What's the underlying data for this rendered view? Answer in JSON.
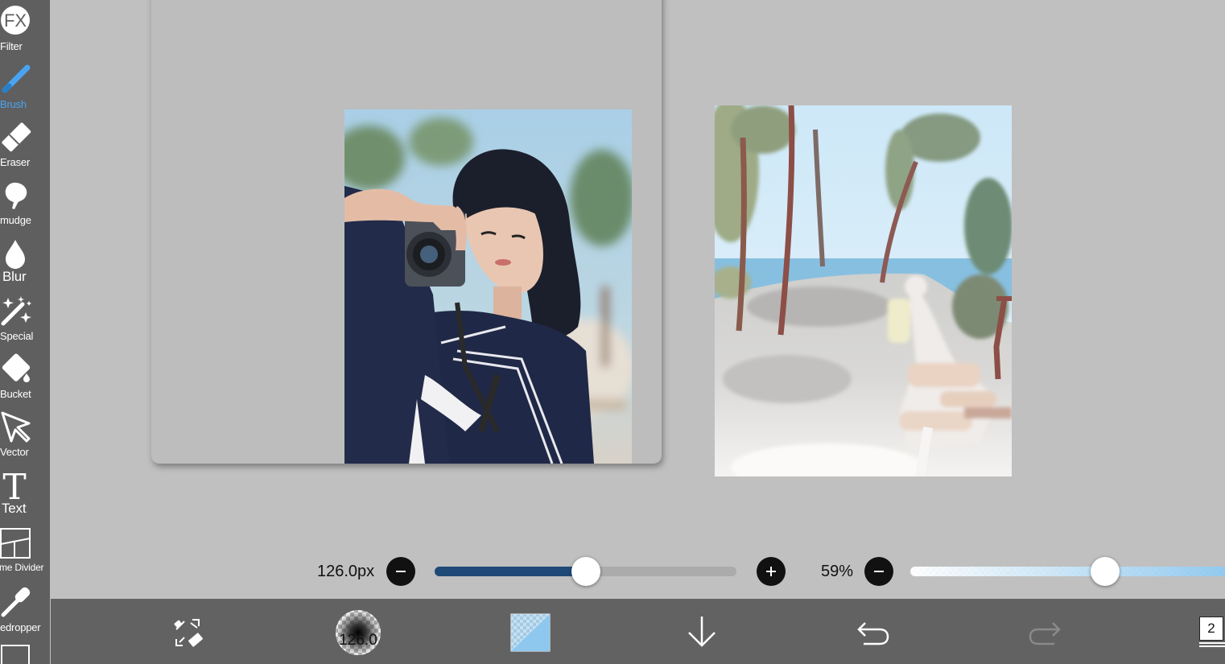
{
  "toolbar": {
    "fx_label": "FX",
    "tools": [
      {
        "id": "filter",
        "label": "Filter"
      },
      {
        "id": "brush",
        "label": "Brush"
      },
      {
        "id": "eraser",
        "label": "Eraser"
      },
      {
        "id": "smudge",
        "label": "mudge"
      },
      {
        "id": "blur",
        "label": "Blur"
      },
      {
        "id": "special",
        "label": "Special"
      },
      {
        "id": "bucket",
        "label": "Bucket"
      },
      {
        "id": "vector",
        "label": "Vector"
      },
      {
        "id": "text",
        "label": "Text"
      },
      {
        "id": "frame-divider",
        "label": "me Divider"
      },
      {
        "id": "eyedropper",
        "label": "edropper"
      }
    ],
    "active_tool": "brush"
  },
  "brush_settings": {
    "size_text": "126.0px",
    "size_fraction": 0.5,
    "opacity_text": "59%",
    "opacity_fraction": 0.59
  },
  "bottom_bar": {
    "brush_size_label": "126.0",
    "layer_count": "2"
  },
  "colors": {
    "accent": "#4aa3f0",
    "toolbar_bg": "#5f5f5f",
    "bottom_bar_bg": "#626262",
    "canvas_bg": "#c0c0c0",
    "size_track_fill": "#1f4a78",
    "opacity_track_fill": "#8ec8ef"
  },
  "icons": {
    "fx": "fx-circle-icon",
    "brush": "brush-icon",
    "eraser": "eraser-icon",
    "smudge": "smudge-icon",
    "blur": "drop-icon",
    "special": "magic-wand-icon",
    "bucket": "bucket-icon",
    "vector": "cursor-arrow-icon",
    "text": "text-T-icon",
    "frame_divider": "frame-divider-icon",
    "eyedropper": "eyedropper-icon",
    "transform": "transform-icon",
    "download": "arrow-down-icon",
    "undo": "undo-icon",
    "redo": "redo-icon",
    "layers": "layers-icon"
  }
}
